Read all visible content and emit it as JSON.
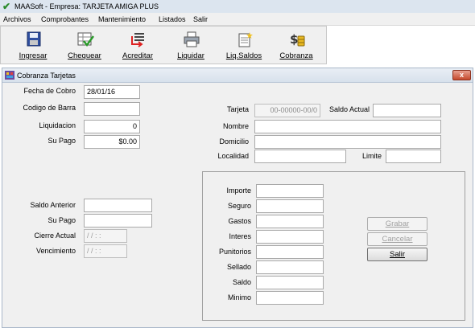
{
  "app": {
    "title": "MAASoft - Empresa: TARJETA AMIGA PLUS"
  },
  "menu": [
    "Archivos",
    "Comprobantes",
    "Mantenimiento",
    "Listados",
    "Salir"
  ],
  "toolbar": [
    {
      "label": "Ingresar",
      "icon": "floppy-disk-icon"
    },
    {
      "label": "Chequear",
      "icon": "spreadsheet-check-icon"
    },
    {
      "label": "Acreditar",
      "icon": "list-arrow-icon"
    },
    {
      "label": "Liquidar",
      "icon": "printer-icon"
    },
    {
      "label": "Liq.Saldos",
      "icon": "document-star-icon"
    },
    {
      "label": "Cobranza",
      "icon": "dollar-coins-icon"
    }
  ],
  "child": {
    "title": "Cobranza Tarjetas",
    "close": "x",
    "left_top": {
      "fecha_label": "Fecha de Cobro",
      "fecha_value": "28/01/16",
      "codigo_label": "Codigo de Barra",
      "codigo_value": "",
      "liquidacion_label": "Liquidacion",
      "liquidacion_value": "0",
      "supago_label": "Su Pago",
      "supago_value": "$0.00"
    },
    "right_top": {
      "tarjeta_label": "Tarjeta",
      "tarjeta_value": "00-00000-00/0",
      "saldo_actual_label": "Saldo Actual",
      "saldo_actual_value": "",
      "nombre_label": "Nombre",
      "nombre_value": "",
      "domicilio_label": "Domicilio",
      "domicilio_value": "",
      "localidad_label": "Localidad",
      "localidad_value": "",
      "limite_label": "Limite",
      "limite_value": ""
    },
    "left_bottom": {
      "saldo_anterior_label": "Saldo Anterior",
      "saldo_anterior_value": "",
      "supago2_label": "Su Pago",
      "supago2_value": "",
      "cierre_label": "Cierre Actual",
      "cierre_value": "/ /      : :",
      "venc_label": "Vencimiento",
      "venc_value": "/ /      : :"
    },
    "group": {
      "importe_label": "Importe",
      "seguro_label": "Seguro",
      "gastos_label": "Gastos",
      "intereses_label": "Interes",
      "punitorios_label": "Punitorios",
      "sellado_label": "Sellado",
      "saldo_label": "Saldo",
      "minimo_label": "Minimo"
    },
    "buttons": {
      "grabar": "Grabar",
      "cancelar": "Cancelar",
      "salir": "Salir"
    }
  },
  "colors": {
    "accent": "#c5492c",
    "title_bar": "#dce5ef"
  }
}
